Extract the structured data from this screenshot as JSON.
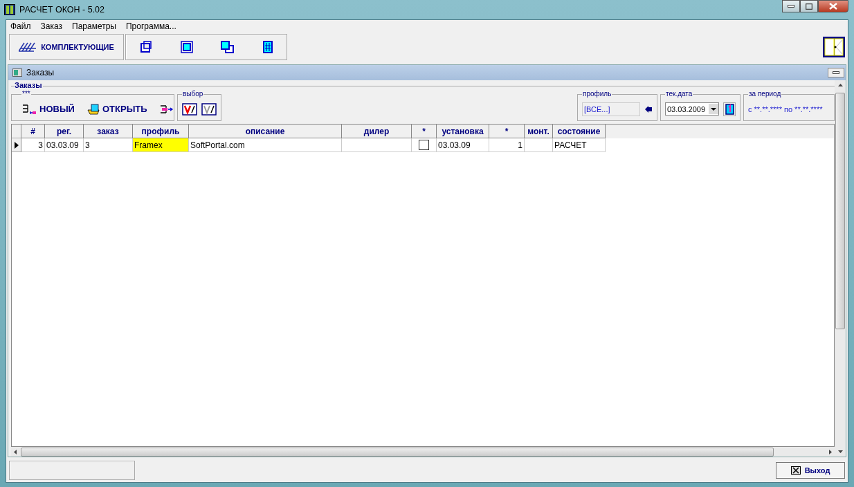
{
  "window": {
    "title": "РАСЧЕТ ОКОН - 5.02"
  },
  "menu": [
    "Файл",
    "Заказ",
    "Параметры",
    "Программа..."
  ],
  "toolbar": {
    "components_button": "КОМПЛЕКТУЮЩИЕ"
  },
  "child_window": {
    "title": "Заказы"
  },
  "group": {
    "title": "Заказы",
    "actions_title": "***",
    "new_button": "НОВЫЙ",
    "open_button": "ОТКРЫТЬ",
    "select_title": "выбор",
    "profile_title": "профиль",
    "profile_value": "[ВСЕ...]",
    "date_title": "тек.дата",
    "date_value": "03.03.2009",
    "period_title": "за период",
    "period_value": "с **.**.**** по **.**.****"
  },
  "table": {
    "columns": [
      "#",
      "рег.",
      "заказ",
      "профиль",
      "описание",
      "дилер",
      "*",
      "установка",
      "*",
      "монт.",
      "состояние"
    ],
    "rows": [
      {
        "selected": true,
        "num": "3",
        "reg": "03.03.09",
        "order": "3",
        "profile": "Framex",
        "color": "#ffff00",
        "description": "SoftPortal.com",
        "dealer": "",
        "checked": false,
        "install": "03.03.09",
        "count": "1",
        "mount": "",
        "state": "РАСЧЕТ"
      }
    ]
  },
  "exit_button": "Выход"
}
